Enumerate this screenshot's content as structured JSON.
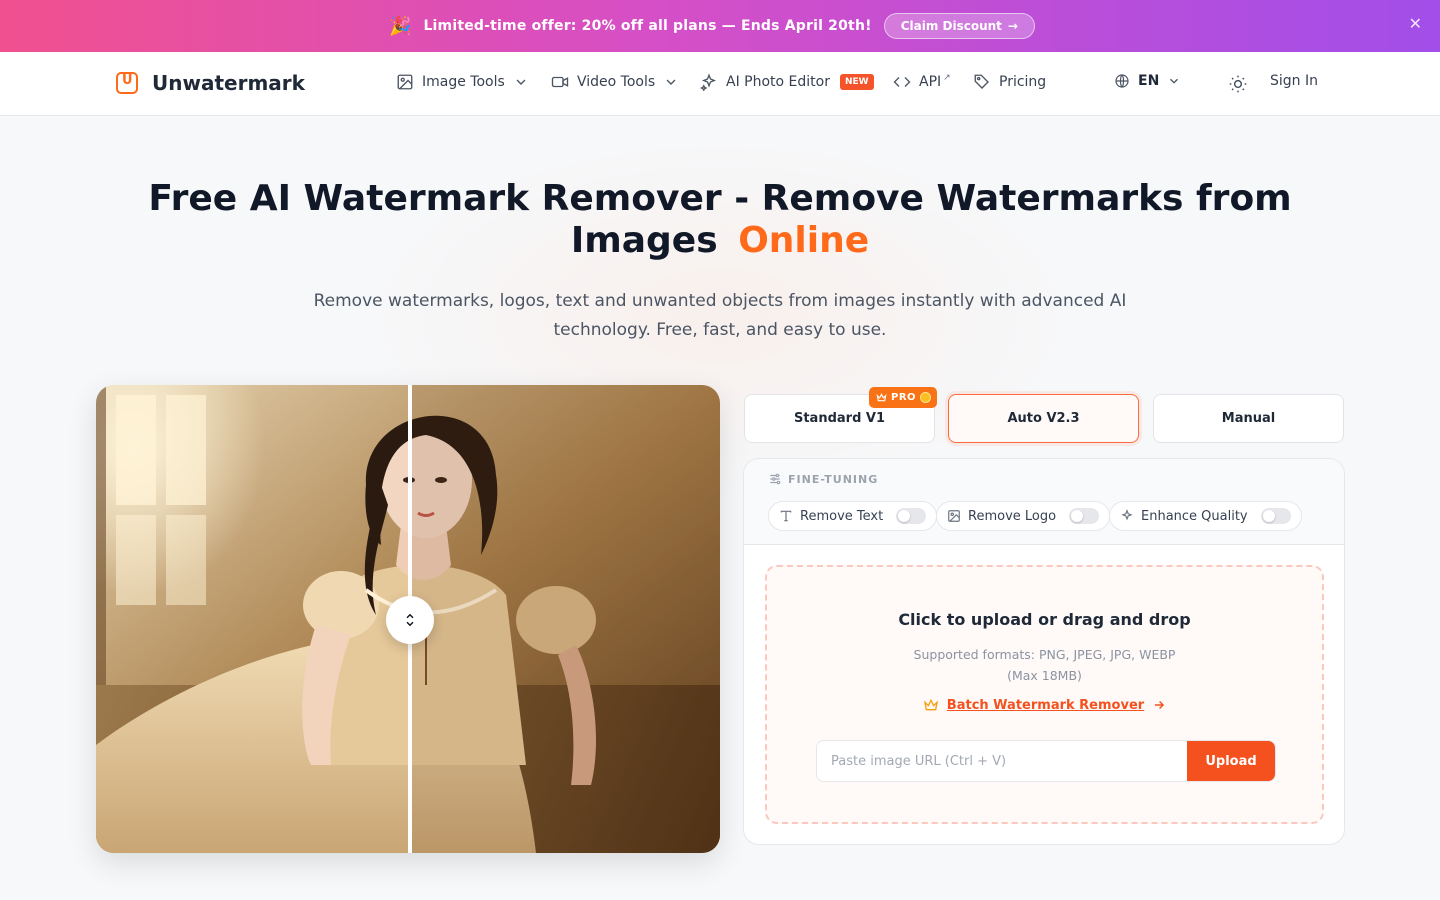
{
  "promo": {
    "emoji": "🎉",
    "text": "Limited-time offer: 20% off all plans — Ends April 20th!",
    "cta": "Claim Discount",
    "close": "✕"
  },
  "nav": {
    "brand": "Unwatermark",
    "image_tools": "Image Tools",
    "video_tools": "Video Tools",
    "ai_photo_editor": "AI Photo Editor",
    "new_badge": "NEW",
    "api": "API",
    "pricing": "Pricing",
    "language": "EN",
    "sign_in": "Sign In"
  },
  "hero": {
    "title_part1": "Free AI Watermark Remover - Remove Watermarks from Images",
    "title_accent": "Online",
    "subtitle": "Remove watermarks, logos, text and unwanted objects from images instantly with advanced AI technology. Free, fast, and easy to use."
  },
  "modes": {
    "standard": "Standard V1",
    "auto": "Auto V2.3",
    "manual": "Manual",
    "pro_badge": "PRO",
    "active": "auto"
  },
  "fine_tuning": {
    "label": "FINE-TUNING",
    "options": [
      {
        "label": "Remove Text",
        "enabled": false
      },
      {
        "label": "Remove Logo",
        "enabled": false
      },
      {
        "label": "Enhance Quality",
        "enabled": false
      }
    ]
  },
  "upload": {
    "title": "Click to upload or drag and drop",
    "formats": "Supported formats: PNG, JPEG, JPG, WEBP",
    "max": "(Max 18MB)",
    "batch_link": "Batch Watermark Remover",
    "url_placeholder": "Paste image URL (Ctrl + V)",
    "upload_button": "Upload"
  },
  "colors": {
    "accent": "#ff6a1a",
    "cta": "#f4511e",
    "promo_start": "#f0508f",
    "promo_end": "#a24ee9"
  }
}
